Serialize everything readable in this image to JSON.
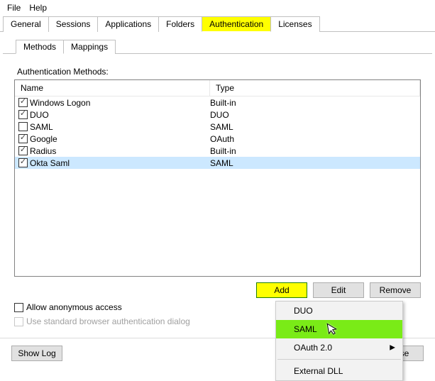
{
  "menubar": {
    "file": "File",
    "help": "Help"
  },
  "tabs": [
    "General",
    "Sessions",
    "Applications",
    "Folders",
    "Authentication",
    "Licenses"
  ],
  "active_tab": "Authentication",
  "subtabs": [
    "Methods",
    "Mappings"
  ],
  "active_subtab": "Methods",
  "section_label": "Authentication Methods:",
  "table": {
    "columns": {
      "name": "Name",
      "type": "Type"
    },
    "rows": [
      {
        "checked": true,
        "name": "Windows Logon",
        "type": "Built-in",
        "selected": false
      },
      {
        "checked": true,
        "name": "DUO",
        "type": "DUO",
        "selected": false
      },
      {
        "checked": false,
        "name": "SAML",
        "type": "SAML",
        "selected": false
      },
      {
        "checked": true,
        "name": "Google",
        "type": "OAuth",
        "selected": false
      },
      {
        "checked": true,
        "name": "Radius",
        "type": "Built-in",
        "selected": false
      },
      {
        "checked": true,
        "name": "Okta Saml",
        "type": "SAML",
        "selected": true
      }
    ]
  },
  "buttons": {
    "add": "Add",
    "edit": "Edit",
    "remove": "Remove",
    "showlog": "Show Log",
    "close": "Close"
  },
  "options": {
    "anonymous": "Allow anonymous access",
    "standard_browser": "Use standard browser authentication dialog"
  },
  "dropdown": {
    "items": [
      {
        "label": "DUO",
        "hover": false,
        "submenu": false
      },
      {
        "label": "SAML",
        "hover": true,
        "submenu": false
      },
      {
        "label": "OAuth 2.0",
        "hover": false,
        "submenu": true
      },
      {
        "label": "External DLL",
        "hover": false,
        "submenu": false,
        "sep_before": true
      }
    ]
  }
}
